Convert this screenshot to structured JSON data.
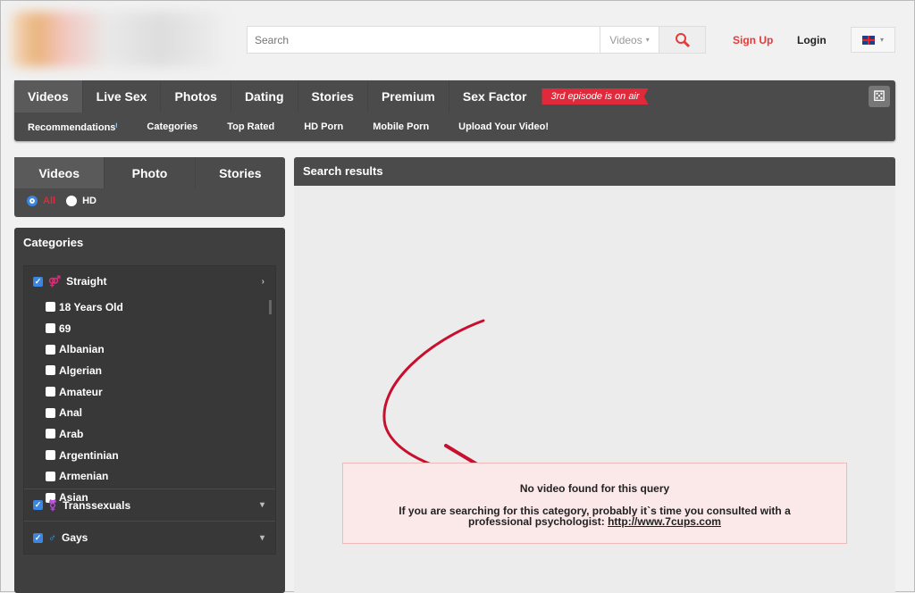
{
  "header": {
    "search_placeholder": "Search",
    "search_scope": "Videos",
    "signup": "Sign Up",
    "login": "Login"
  },
  "nav": {
    "tabs": [
      "Videos",
      "Live Sex",
      "Photos",
      "Dating",
      "Stories",
      "Premium",
      "Sex Factor"
    ],
    "badge": "3rd episode is on air",
    "sub": [
      "Recommendations",
      "Categories",
      "Top Rated",
      "HD Porn",
      "Mobile Porn",
      "Upload Your Video!"
    ]
  },
  "sidebar": {
    "tabs": [
      "Videos",
      "Photo",
      "Stories"
    ],
    "filter_all": "All",
    "filter_hd": "HD",
    "categories_title": "Categories",
    "groups": {
      "straight": "Straight",
      "trans": "Transsexuals",
      "gays": "Gays"
    },
    "items": [
      "18 Years Old",
      "69",
      "Albanian",
      "Algerian",
      "Amateur",
      "Anal",
      "Arab",
      "Argentinian",
      "Armenian",
      "Asian"
    ]
  },
  "main": {
    "title": "Search results",
    "message_title": "No video found for this query",
    "message_body": "If you are searching for this category, probably it`s time you consulted with a professional psychologist:",
    "message_link": "http://www.7cups.com"
  },
  "colors": {
    "accent_red": "#e0293a",
    "nav_bg": "#4b4b4b",
    "message_bg": "#fbe9e9",
    "arrow": "#c8102e"
  }
}
